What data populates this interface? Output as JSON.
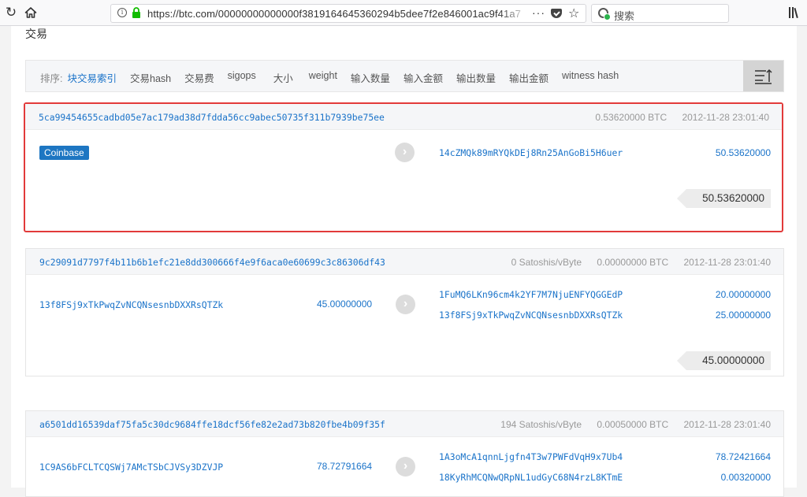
{
  "browser": {
    "url": "https://btc.com/00000000000000f3819164645360294b5dee7f2e846001ac9f41a7",
    "more_icon": "···",
    "search_placeholder": "搜索"
  },
  "page": {
    "section_title": "交易"
  },
  "sort": {
    "label": "排序:",
    "options": [
      "块交易索引",
      "交易hash",
      "交易费",
      "sigops",
      "大小",
      "weight",
      "输入数量",
      "输入金额",
      "输出数量",
      "输出金额",
      "witness hash"
    ],
    "active": "块交易索引"
  },
  "transactions": [
    {
      "hash": "5ca99454655cadbd05e7ac179ad38d7fdda56cc9abec50735f311b7939be75ee",
      "fee_rate": "",
      "fee": "0.53620000 BTC",
      "time": "2012-11-28 23:01:40",
      "input_badge": "Coinbase",
      "outputs": [
        {
          "address": "14cZMQk89mRYQkDEj8Rn25AnGoBi5H6uer",
          "amount": "50.53620000"
        }
      ],
      "total": "50.53620000"
    },
    {
      "hash": "9c29091d7797f4b11b6b1efc21e8dd300666f4e9f6aca0e60699c3c86306df43",
      "fee_rate": "0 Satoshis/vByte",
      "fee": "0.00000000 BTC",
      "time": "2012-11-28 23:01:40",
      "inputs": [
        {
          "address": "13f8FSj9xTkPwqZvNCQNsesnbDXXRsQTZk",
          "amount": "45.00000000"
        }
      ],
      "outputs": [
        {
          "address": "1FuMQ6LKn96cm4k2YF7M7NjuENFYQGGEdP",
          "amount": "20.00000000"
        },
        {
          "address": "13f8FSj9xTkPwqZvNCQNsesnbDXXRsQTZk",
          "amount": "25.00000000"
        }
      ],
      "total": "45.00000000"
    },
    {
      "hash": "a6501dd16539daf75fa5c30dc9684ffe18dcf56fe82e2ad73b820fbe4b09f35f",
      "fee_rate": "194 Satoshis/vByte",
      "fee": "0.00050000 BTC",
      "time": "2012-11-28 23:01:40",
      "inputs": [
        {
          "address": "1C9AS6bFCLTCQSWj7AMcTSbCJVSy3DZVJP",
          "amount": "78.72791664"
        }
      ],
      "outputs": [
        {
          "address": "1A3oMcA1qnnLjgfn4T3w7PWFdVqH9x7Ub4",
          "amount": "78.72421664"
        },
        {
          "address": "18KyRhMCQNwQRpNL1udGyC68N4rzL8KTmE",
          "amount": "0.00320000"
        }
      ]
    }
  ]
}
